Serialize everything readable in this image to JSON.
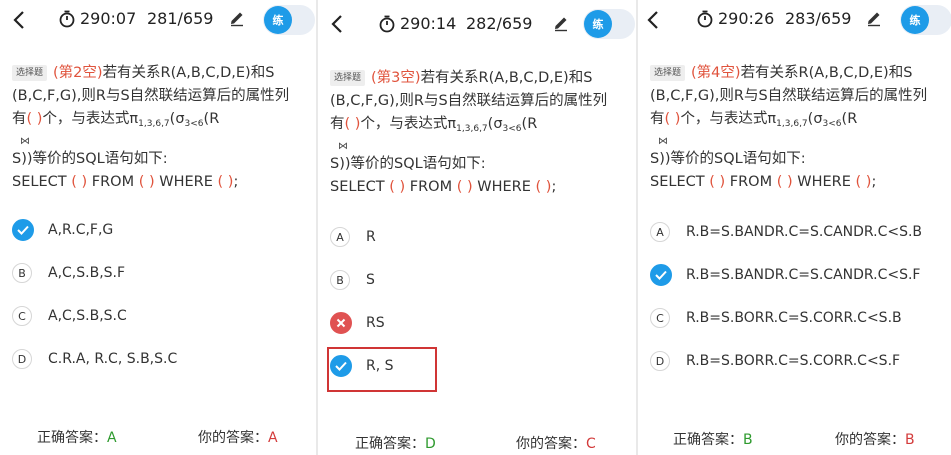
{
  "panels": [
    {
      "timer": "290:07",
      "progress": "281/659",
      "practice_label": "练",
      "question": {
        "type_tag": "选择题",
        "blank_label": "(第2空)",
        "line1": "若有关系R(A,B,C,D,E)和S",
        "line2": "(B,C,F,G),则R与S自然联结运算后的属性列",
        "line3_a": "有",
        "paren": "( )",
        "line3_b": "个，与表达式π",
        "pi_sub": "1,3,6,7",
        "open": "(σ",
        "sigma_sub": "3<6",
        "line3_c": "(R",
        "join_symbol": "⋈",
        "line4": "S))等价的SQL语句如下:",
        "sql_select": "SELECT",
        "sql_from": "FROM",
        "sql_where": "WHERE",
        "sql_end": ";"
      },
      "options": [
        {
          "letter": "A",
          "text": "A,R.C,F,G",
          "state": "correct"
        },
        {
          "letter": "B",
          "text": "A,C,S.B,S.F",
          "state": "none"
        },
        {
          "letter": "C",
          "text": "A,C,S.B,S.C",
          "state": "none"
        },
        {
          "letter": "D",
          "text": "C.R.A, R.C, S.B,S.C",
          "state": "none"
        }
      ],
      "correct_label": "正确答案：",
      "correct_answer": "A",
      "your_label": "你的答案：",
      "your_answer": "A"
    },
    {
      "timer": "290:14",
      "progress": "282/659",
      "practice_label": "练",
      "question": {
        "type_tag": "选择题",
        "blank_label": "(第3空)",
        "line1": "若有关系R(A,B,C,D,E)和S",
        "line2": "(B,C,F,G),则R与S自然联结运算后的属性列",
        "line3_a": "有",
        "paren": "( )",
        "line3_b": "个，与表达式π",
        "pi_sub": "1,3,6,7",
        "open": "(σ",
        "sigma_sub": "3<6",
        "line3_c": "(R",
        "join_symbol": "⋈",
        "line4": "S))等价的SQL语句如下:",
        "sql_select": "SELECT",
        "sql_from": "FROM",
        "sql_where": "WHERE",
        "sql_end": ";"
      },
      "options": [
        {
          "letter": "A",
          "text": "R",
          "state": "none"
        },
        {
          "letter": "B",
          "text": "S",
          "state": "none"
        },
        {
          "letter": "C",
          "text": "RS",
          "state": "wrong"
        },
        {
          "letter": "D",
          "text": "R, S",
          "state": "correct"
        }
      ],
      "correct_label": "正确答案：",
      "correct_answer": "D",
      "your_label": "你的答案：",
      "your_answer": "C"
    },
    {
      "timer": "290:26",
      "progress": "283/659",
      "practice_label": "练",
      "question": {
        "type_tag": "选择题",
        "blank_label": "(第4空)",
        "line1": "若有关系R(A,B,C,D,E)和S",
        "line2": "(B,C,F,G),则R与S自然联结运算后的属性列",
        "line3_a": "有",
        "paren": "( )",
        "line3_b": "个，与表达式π",
        "pi_sub": "1,3,6,7",
        "open": "(σ",
        "sigma_sub": "3<6",
        "line3_c": "(R",
        "join_symbol": "⋈",
        "line4": "S))等价的SQL语句如下:",
        "sql_select": "SELECT",
        "sql_from": "FROM",
        "sql_where": "WHERE",
        "sql_end": ";"
      },
      "options": [
        {
          "letter": "A",
          "text": "R.B=S.BANDR.C=S.CANDR.C<S.B",
          "state": "none"
        },
        {
          "letter": "B",
          "text": "R.B=S.BANDR.C=S.CANDR.C<S.F",
          "state": "correct"
        },
        {
          "letter": "C",
          "text": "R.B=S.BORR.C=S.CORR.C<S.B",
          "state": "none"
        },
        {
          "letter": "D",
          "text": "R.B=S.BORR.C=S.CORR.C<S.F",
          "state": "none"
        }
      ],
      "correct_label": "正确答案：",
      "correct_answer": "B",
      "your_label": "你的答案：",
      "your_answer": "B"
    }
  ],
  "colors": {
    "accent": "#1e9be8",
    "wrong": "#e05252",
    "blank_label": "#e0533c",
    "correct_text": "#2e9a2e",
    "your_text": "#d33b3b"
  }
}
